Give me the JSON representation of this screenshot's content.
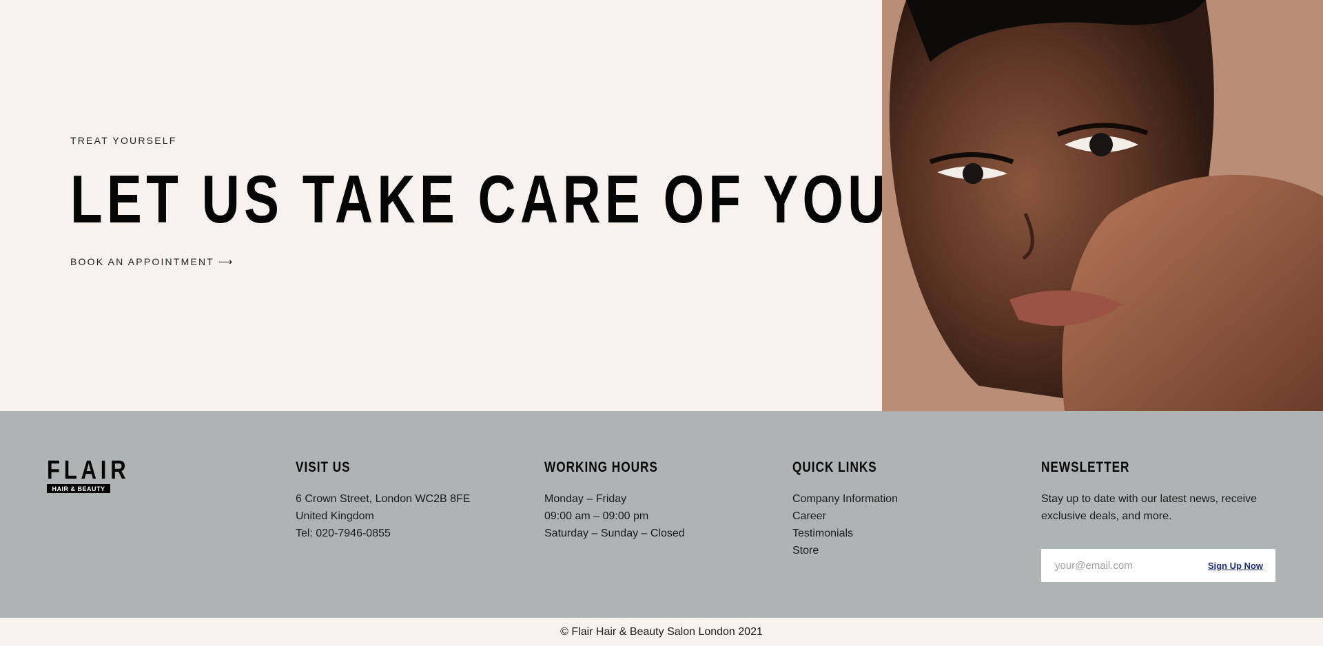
{
  "hero": {
    "eyebrow": "TREAT YOURSELF",
    "headline": "LET US TAKE CARE OF YOU",
    "cta_label": "BOOK AN APPOINTMENT",
    "cta_arrow": "⟶"
  },
  "footer": {
    "logo": {
      "word": "FLAIR",
      "subtitle": "HAIR & BEAUTY"
    },
    "visit": {
      "title": "VISIT US",
      "lines": [
        "6 Crown Street, London WC2B 8FE",
        "United Kingdom",
        "Tel: 020-7946-0855"
      ]
    },
    "hours": {
      "title": "WORKING HOURS",
      "lines": [
        "Monday – Friday",
        "09:00 am – 09:00 pm",
        "Saturday – Sunday – Closed"
      ]
    },
    "links": {
      "title": "QUICK LINKS",
      "items": [
        "Company Information",
        "Career",
        "Testimonials",
        "Store"
      ]
    },
    "newsletter": {
      "title": "NEWSLETTER",
      "text": "Stay up to date with our latest news, receive exclusive deals, and more.",
      "placeholder": "your@email.com",
      "button": "Sign Up Now"
    }
  },
  "copyright": "© Flair Hair & Beauty Salon London 2021",
  "colors": {
    "hero_bg": "#f7f2ed",
    "footer_bg": "#aeb4b4",
    "signup_link": "#1d2d73"
  }
}
